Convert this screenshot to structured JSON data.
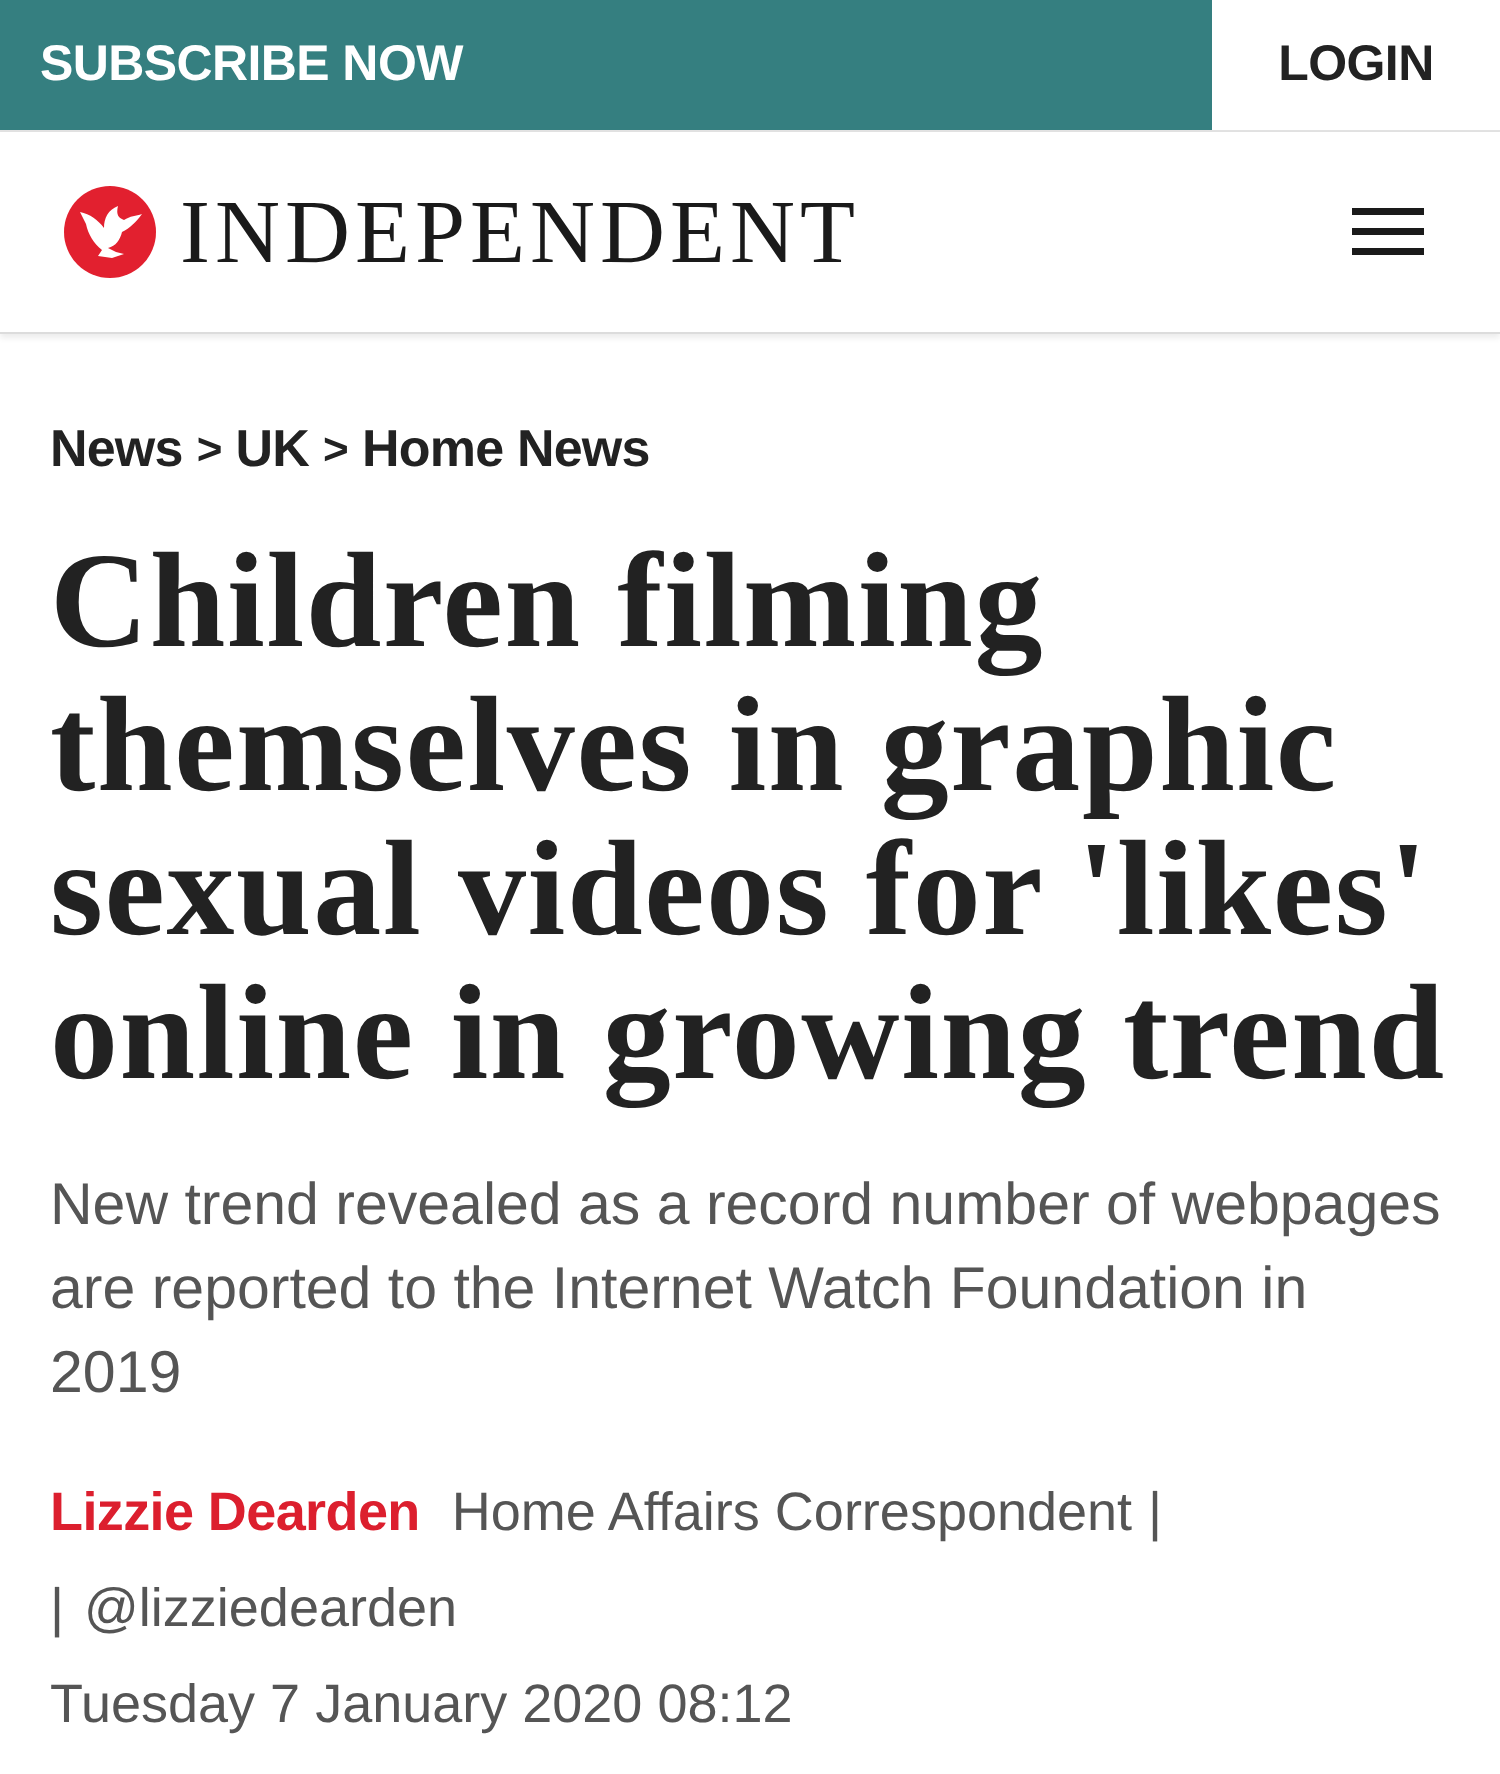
{
  "top_bar": {
    "subscribe_button": "SUBSCRIBE NOW",
    "login_button": "LOGIN"
  },
  "header": {
    "logo_text": "INDEPENDENT"
  },
  "breadcrumb": [
    {
      "kind": "link",
      "text": "News"
    },
    {
      "kind": "separator",
      "text": ">"
    },
    {
      "kind": "link",
      "text": "UK"
    },
    {
      "kind": "separator",
      "text": ">"
    },
    {
      "kind": "link",
      "text": "Home News"
    }
  ],
  "article": {
    "headline": "Children filming themselves in graphic sexual videos for 'likes' online in growing trend",
    "standfirst": "New trend revealed as a record number of webpages are reported to the Internet Watch Foundation in 2019",
    "byline": {
      "author": "Lizzie Dearden",
      "role": "Home Affairs Correspondent",
      "separator_1": "|",
      "separator_2": "|",
      "handle": "@lizziedearden"
    },
    "date": "Tuesday 7 January 2020 08:12"
  }
}
